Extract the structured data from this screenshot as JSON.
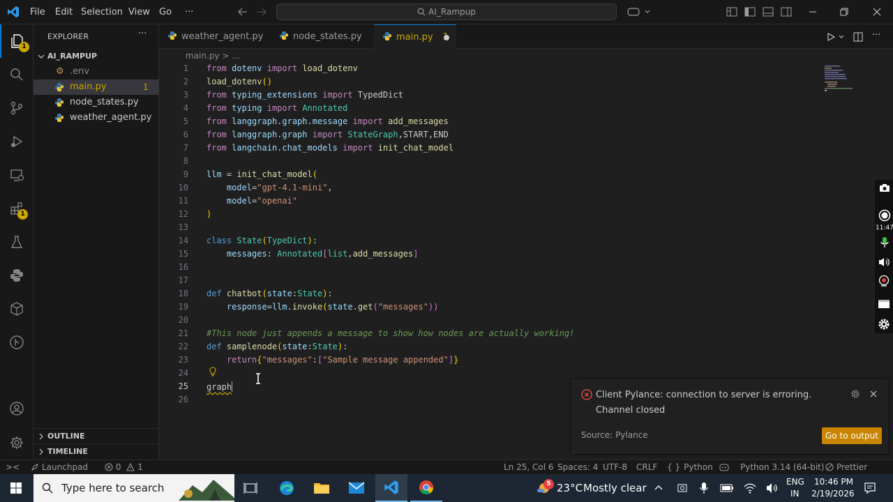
{
  "titlebar": {
    "menu": [
      "File",
      "Edit",
      "Selection",
      "View",
      "Go",
      "···"
    ],
    "search": "AI_Rampup"
  },
  "activity": {
    "explorer_badge": "1",
    "extensions_badge": "1"
  },
  "sidebar": {
    "header": "EXPLORER",
    "more": "···",
    "folder": "AI_RAMPUP",
    "files": [
      {
        "name": ".env",
        "badge": ""
      },
      {
        "name": "main.py",
        "badge": "1"
      },
      {
        "name": "node_states.py",
        "badge": ""
      },
      {
        "name": "weather_agent.py",
        "badge": ""
      }
    ],
    "outline": "OUTLINE",
    "timeline": "TIMELINE"
  },
  "tabs": [
    {
      "label": "weather_agent.py"
    },
    {
      "label": "node_states.py"
    },
    {
      "label": "main.py",
      "badge": "1"
    }
  ],
  "editor": {
    "breadcrumb": "main.py > ...",
    "line_numbers": [
      "1",
      "2",
      "3",
      "4",
      "5",
      "6",
      "7",
      "8",
      "9",
      "10",
      "11",
      "12",
      "13",
      "14",
      "15",
      "16",
      "17",
      "18",
      "19",
      "20",
      "21",
      "22",
      "23",
      "24",
      "25",
      "26"
    ]
  },
  "notification": {
    "message": "Client Pylance: connection to server is erroring. Channel closed",
    "source": "Source: Pylance",
    "button": "Go to output"
  },
  "statusbar": {
    "remote": "><",
    "launchpad": "Launchpad",
    "errors": "0",
    "warnings": "1",
    "position": "Ln 25, Col 6",
    "spaces": "Spaces: 4",
    "encoding": "UTF-8",
    "eol": "CRLF",
    "language": "Python",
    "interpreter": "Python 3.14 (64-bit)",
    "formatter": "Prettier"
  },
  "taskbar": {
    "search_placeholder": "Type here to search",
    "weather_temp": "23°C",
    "weather_text": "Mostly clear",
    "weather_badge": "5",
    "lang_top": "ENG",
    "lang_bottom": "IN",
    "time": "10:46 PM",
    "date": "2/19/2026"
  },
  "floatbar": {
    "time": "11:47"
  },
  "colors": {
    "accent": "#0078d4",
    "badge": "#cca700",
    "error": "#f14c4c",
    "button": "#c98500"
  }
}
